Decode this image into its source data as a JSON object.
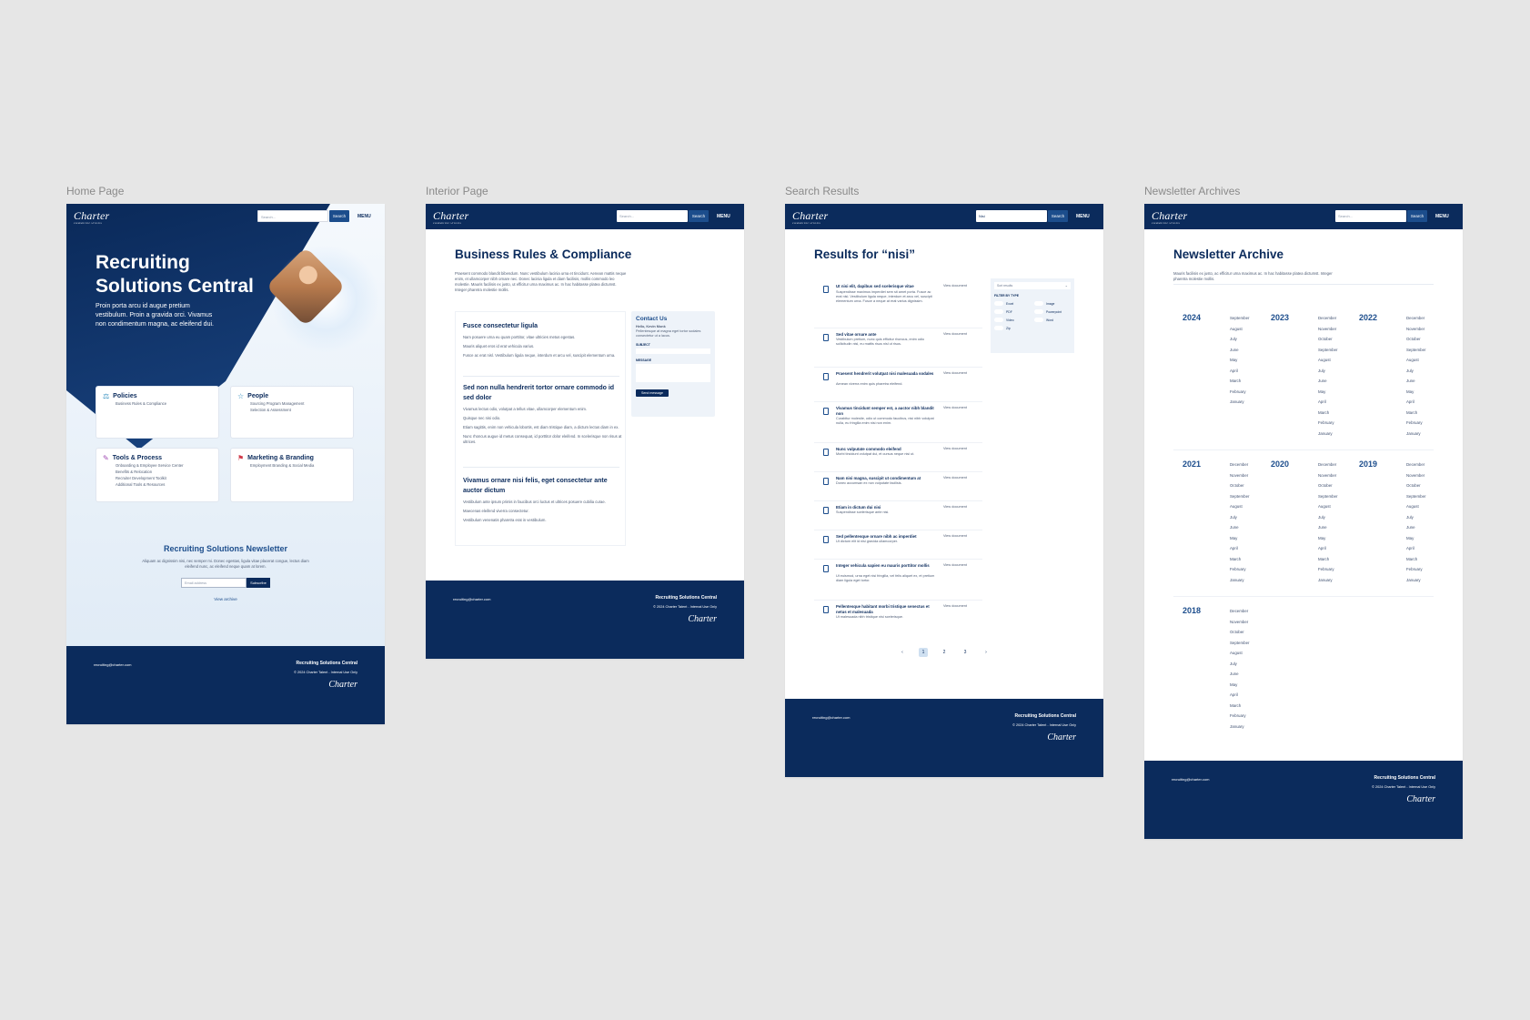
{
  "columns": [
    "Home Page",
    "Interior Page",
    "Search Results",
    "Newsletter Archives"
  ],
  "brand": {
    "logo": "Charter",
    "logo_sub": "COMMUNICATIONS",
    "navy": "#0b2b5c",
    "accent": "#1c4d8c"
  },
  "header": {
    "search_placeholder": "Search...",
    "search_button": "Search",
    "menu": "MENU"
  },
  "home": {
    "title": "Recruiting Solutions Central",
    "subtitle": "Proin porta arcu id augue pretium vestibulum. Proin a gravida orci. Vivamus non condimentum magna, ac eleifend dui.",
    "cards": [
      {
        "title": "Policies",
        "icon": "scales-icon",
        "links": [
          "Business Rules & Compliance"
        ]
      },
      {
        "title": "People",
        "icon": "star-icon",
        "links": [
          "Sourcing Program Management",
          "Selection & Assessment"
        ]
      },
      {
        "title": "Tools & Process",
        "icon": "wrench-icon",
        "links": [
          "Onboarding & Employee Service Center",
          "Benefits & Relocation",
          "Recruiter Development Toolkit",
          "Additional Tools & Resources"
        ]
      },
      {
        "title": "Marketing & Branding",
        "icon": "megaphone-icon",
        "links": [
          "Employment Branding & Social Media"
        ]
      }
    ],
    "newsletter": {
      "title": "Recruiting Solutions Newsletter",
      "desc": "Aliquam ac dignissim nisi, nec semper mi. Donec egestas, ligula vitae placerat congue, lectus diam eleifend nunc, ac eleifend neque quam at lorem.",
      "placeholder": "Email address",
      "button": "Subscribe",
      "link": "View archive"
    }
  },
  "footer": {
    "email": "recruiting@charter.com",
    "title": "Recruiting Solutions Central",
    "copy": "© 2024 Charter Talent - Internal Use Only",
    "logo": "Charter"
  },
  "interior": {
    "title": "Business Rules & Compliance",
    "intro": "Praesent commodo blandit bibendum. Nunc vestibulum lacinia urna et tincidunt. Aenean mattis neque enim, et ullamcorper nibh ornare nec. Donec lacinia ligula et diam facilisis, mollis commodo leo molestie. Mauris facilisis ex justo, ut efficitur urna maximus ac. In hac habitasse platea dictumst. Integer pharetra molestie mollis.",
    "sections": [
      {
        "title": "Fusce consectetur ligula",
        "paras": [
          "Nam posuere urna eu quam porttitor, vitae ultricies metus egestas.",
          "Mauris aliquet eros id erat vehicula varius.",
          "Fusce ac erat nisl. Vestibulum ligula neque, interdum et arcu vel, suscipit elementum urna."
        ]
      },
      {
        "title": "Sed non nulla hendrerit tortor ornare commodo id sed dolor",
        "paras": [
          "Vivamus lectus odio, volutpat a tellus vitae, ullamcorper elementum enim.",
          "Quisque nec nisi odio.",
          "Etiam sagittis, enim non vehicula lobortis, est diam tristique diam, a dictum lectus diam in ex.",
          "Nunc rhoncus augue id metus consequat, id porttitor dolor eleifend. In scelerisque non risus at ultrices."
        ]
      },
      {
        "title": "Vivamus ornare nisi felis, eget consectetur ante auctor dictum",
        "paras": [
          "Vestibulum ante ipsum primis in faucibus orci luctus et ultrices posuere cubilia curae.",
          "Maecenas eleifend viverra consectetur.",
          "Vestibulum venenatis pharetra erat in vestibulum."
        ]
      }
    ],
    "contact": {
      "title": "Contact Us",
      "name": "Hello, Kevin Monk",
      "text": "Pellentesque at magna eget tortor sodales consectetur ut a lacus.",
      "subject": "SUBJECT",
      "message": "MESSAGE",
      "button": "Send message"
    }
  },
  "search": {
    "title": "Results for “nisi”",
    "query": "Nisi",
    "view": "View document",
    "results": [
      {
        "title": "Ut nisi elit, dapibus sed scelerisque vitae",
        "desc": "Suspendisse maximus imperdiet sem sit amet porta. Fusce ac erat nisl. Vestibulum ligula neque, interdum et arcu vel, suscipit elementum urna. Fusce a neque at erat varius dignissim."
      },
      {
        "title": "Sed vitae ornare ante",
        "desc": "Vestibulum pretium, nunc quis efficitur rhoncus, enim odio sollicitudin nisl, eu mattis risus nisl ut risus."
      },
      {
        "title": "Praesent hendrerit volutpat nisi malesuada sodales",
        "desc": "Aenean viverra enim quis pharetra eleifend."
      },
      {
        "title": "Vivamus tincidunt semper est, a auctor nibh blandit non",
        "desc": "Curabitur molestie, odio ut commodo faucibus, nisi nibh volutpat nulla, eu fringilla enim nisi non enim."
      },
      {
        "title": "Nunc vulputate commodo eleifend",
        "desc": "Morbi tincidunt volutpat dui, et cursus neque nisi ut."
      },
      {
        "title": "Nam nisi magna, suscipit ut condimentum at",
        "desc": "Donec accumsan ex non vulputate facilisis."
      },
      {
        "title": "Etiam in dictum dui nisi",
        "desc": "Suspendisse scelerisque ante nisi."
      },
      {
        "title": "Sed pellentesque ornare nibh ac imperdiet",
        "desc": "Ut dictum elit id nisi gravida ullamcorper."
      },
      {
        "title": "Integer vehicula sapien eu mauris porttitor mollis",
        "desc": "Ut euismod, urna eget nisi fringilla, vel felis aliquet ex, et pretium diam ligula eget tortor."
      },
      {
        "title": "Pellentesque habitant morbi tristique senectus et netus et malesuada",
        "desc": "Ut malesuada nibh tristique nisi scelerisque."
      }
    ],
    "filter": {
      "sort": "Sort results",
      "heading": "FILTER BY TYPE",
      "types": [
        "Excel",
        "Image",
        "PDF",
        "Powerpoint",
        "Video",
        "Word",
        "Zip"
      ]
    },
    "pages": [
      "1",
      "2",
      "3"
    ],
    "prev": "‹",
    "next": "›"
  },
  "archive": {
    "title": "Newsletter Archive",
    "intro": "Mauris facilisis ex justo, ac efficitur urna maximus ac. In hac habitasse platea dictumst. Integer pharetra molestie mollis.",
    "years": [
      {
        "year": "2024",
        "months": [
          "September",
          "August",
          "July",
          "June",
          "May",
          "April",
          "March",
          "February",
          "January"
        ]
      },
      {
        "year": "2023",
        "months": [
          "December",
          "November",
          "October",
          "September",
          "August",
          "July",
          "June",
          "May",
          "April",
          "March",
          "February",
          "January"
        ]
      },
      {
        "year": "2022",
        "months": [
          "December",
          "November",
          "October",
          "September",
          "August",
          "July",
          "June",
          "May",
          "April",
          "March",
          "February",
          "January"
        ]
      },
      {
        "year": "2021",
        "months": [
          "December",
          "November",
          "October",
          "September",
          "August",
          "July",
          "June",
          "May",
          "April",
          "March",
          "February",
          "January"
        ]
      },
      {
        "year": "2020",
        "months": [
          "December",
          "November",
          "October",
          "September",
          "August",
          "July",
          "June",
          "May",
          "April",
          "March",
          "February",
          "January"
        ]
      },
      {
        "year": "2019",
        "months": [
          "December",
          "November",
          "October",
          "September",
          "August",
          "July",
          "June",
          "May",
          "April",
          "March",
          "February",
          "January"
        ]
      },
      {
        "year": "2018",
        "months": [
          "December",
          "November",
          "October",
          "September",
          "August",
          "July",
          "June",
          "May",
          "April",
          "March",
          "February",
          "January"
        ]
      }
    ]
  }
}
